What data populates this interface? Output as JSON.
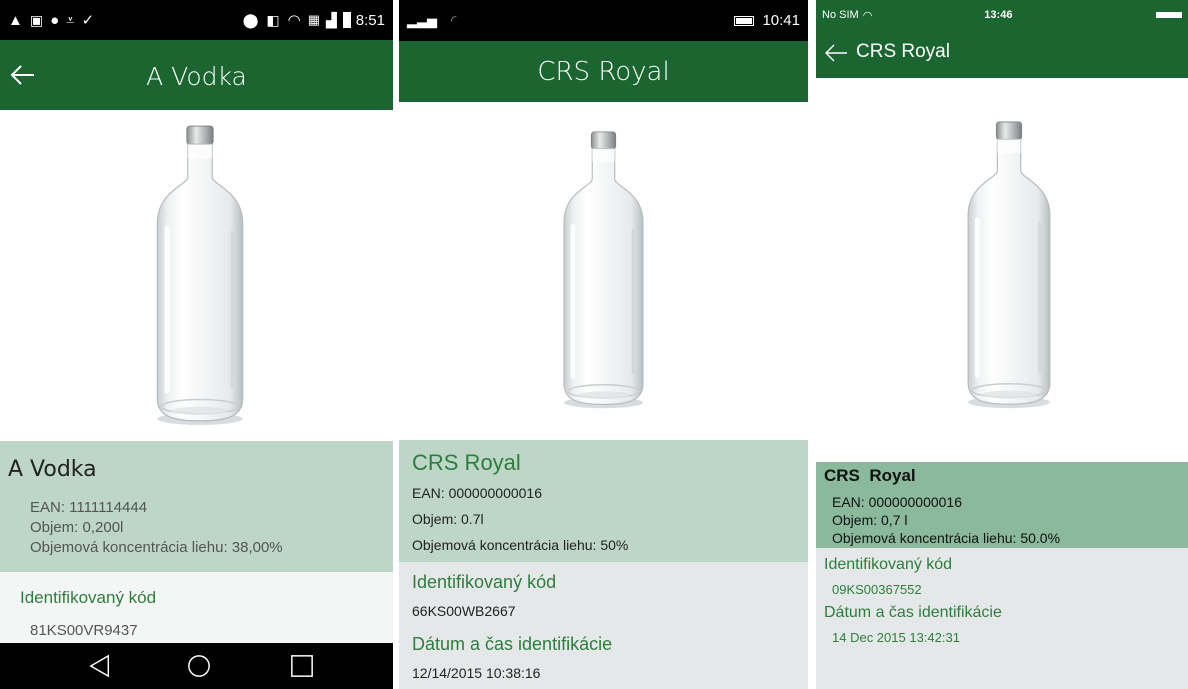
{
  "screens": [
    {
      "status": {
        "time": "8:51"
      },
      "title": "A Vodka",
      "product_name": "A Vodka",
      "ean": "EAN: 1111114444",
      "volume": "Objem: 0,200l",
      "alcohol": "Objemová koncentrácia liehu: 38,00%",
      "code_label": "Identifikovaný kód",
      "code_value": "81KS00VR9437",
      "icons": [
        "back-arrow-icon",
        "nav-back-icon",
        "nav-home-icon",
        "nav-recents-icon",
        "signal-icon",
        "wifi-icon",
        "battery-icon"
      ],
      "colors": {
        "app_bar": "#1b6530",
        "info_bg": "#bdd6c7",
        "text_green": "#2e7d3e"
      }
    },
    {
      "status": {
        "time": "10:41"
      },
      "title": "CRS Royal",
      "product_name": "CRS Royal",
      "ean": "EAN: 000000000016",
      "volume": "Objem: 0.7l",
      "alcohol": "Objemová koncentrácia liehu: 50%",
      "code_label": "Identifikovaný kód",
      "code_value": "66KS00WB2667",
      "date_label": "Dátum a čas identifikácie",
      "date_value": "12/14/2015 10:38:16",
      "colors": {
        "app_bar": "#1b6530",
        "info_bg": "#bdd6c7",
        "info2_bg": "#e5e8e9"
      }
    },
    {
      "status": {
        "carrier": "No SIM",
        "time": "13:46"
      },
      "title": "CRS Royal",
      "product_name": "CRS  Royal",
      "ean": "EAN: 000000000016",
      "volume": "Objem: 0,7 l",
      "alcohol": "Objemová koncentrácia liehu: 50.0%",
      "code_label": "Identifikovaný kód",
      "code_value": "09KS00367552",
      "date_label": "Dátum a čas identifikácie",
      "date_value": "14 Dec 2015 13:42:31",
      "colors": {
        "app_bar": "#1b6530",
        "info_bg": "#8ab99c",
        "info2_bg": "#e5e8e9"
      }
    }
  ]
}
